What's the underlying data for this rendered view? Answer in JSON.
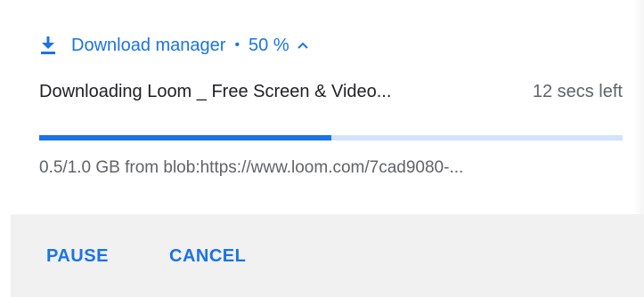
{
  "header": {
    "icon": "download-icon",
    "app_name": "Download manager",
    "separator": "•",
    "percent": "50 %",
    "expand_icon": "chevron-up-icon"
  },
  "download": {
    "filename": "Downloading Loom _ Free Screen & Video...",
    "time_left": "12 secs left",
    "progress": 0.5,
    "detail": "0.5/1.0 GB from blob:https://www.loom.com/7cad9080-..."
  },
  "actions": {
    "pause_label": "PAUSE",
    "cancel_label": "CANCEL"
  },
  "colors": {
    "accent": "#1a73e8",
    "progress_track": "#d2e3fc",
    "footer_bg": "#f1f1f1"
  }
}
